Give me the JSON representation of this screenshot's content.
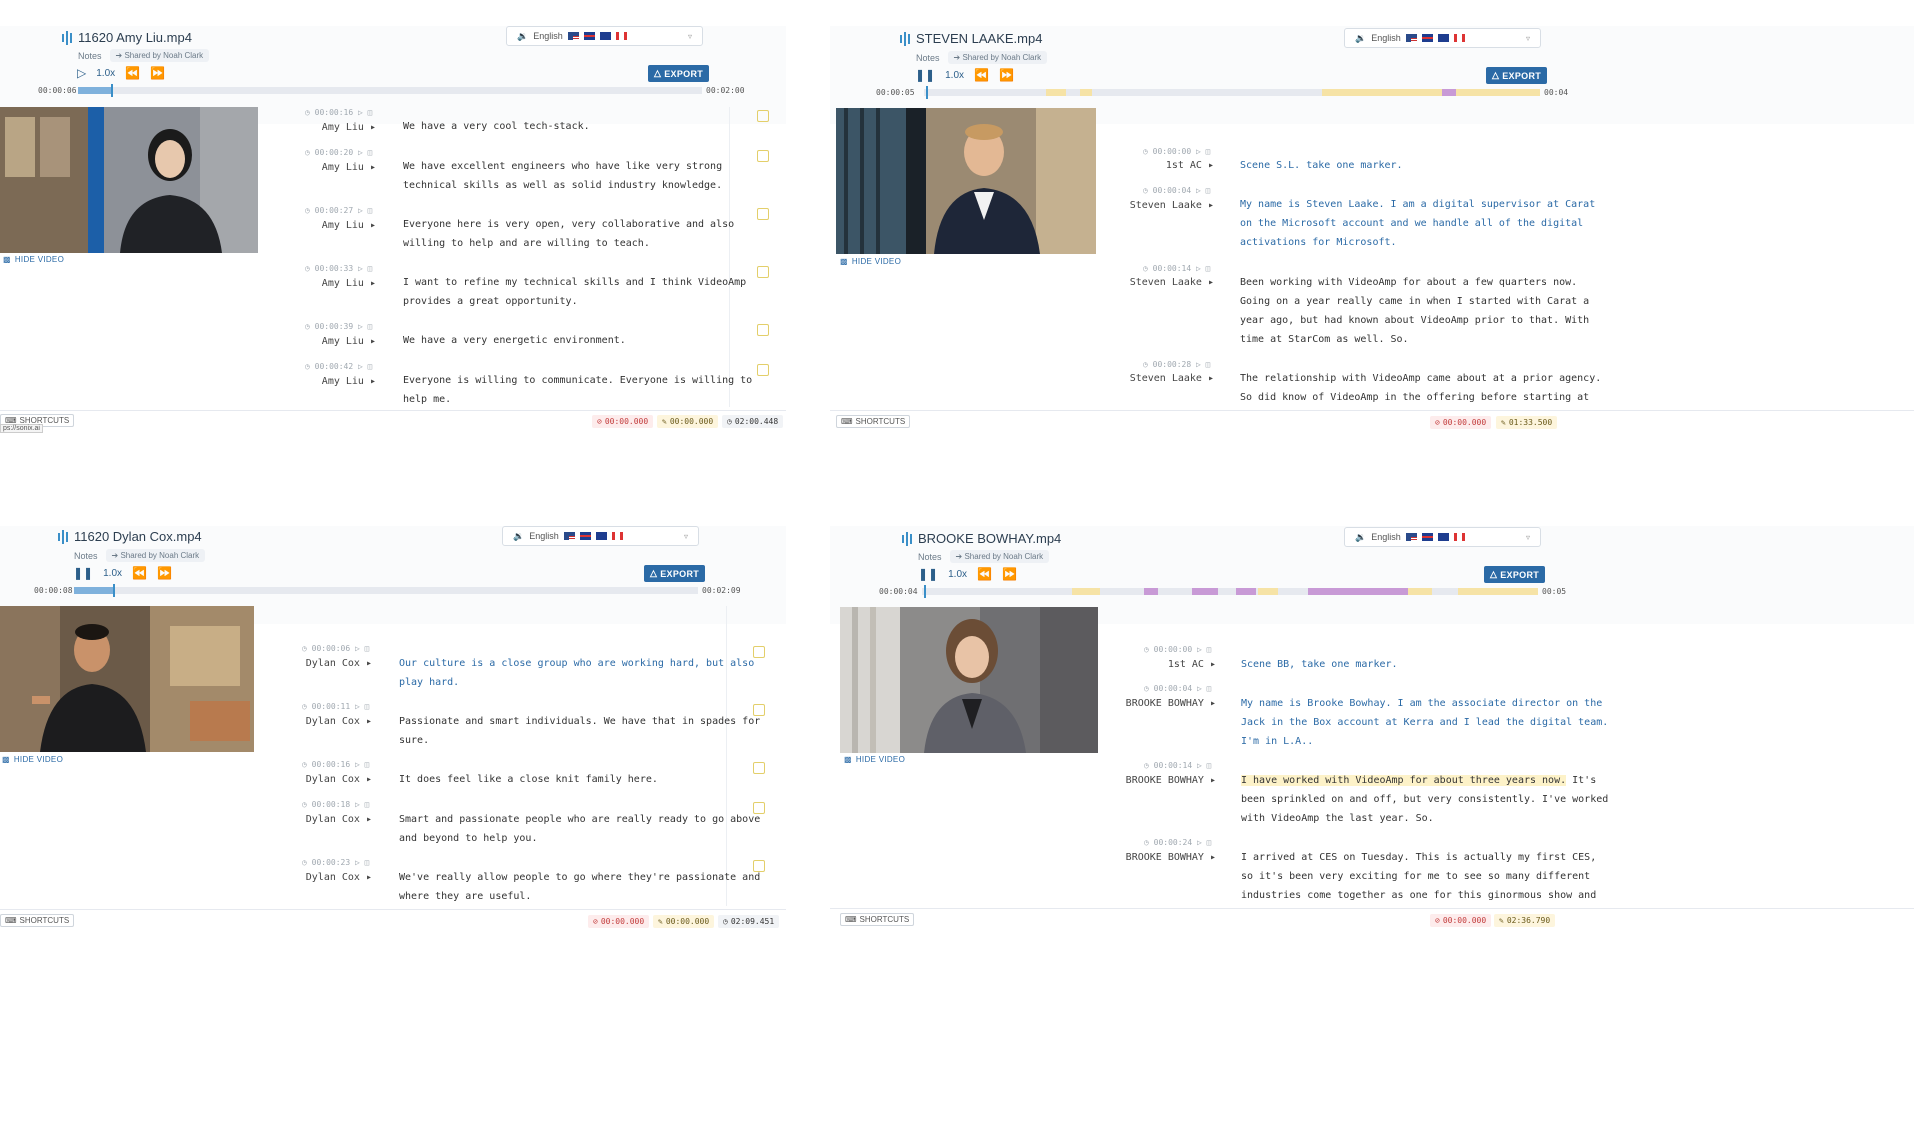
{
  "colors": {
    "accent": "#2b6aa6",
    "progress": "#7fb1dc",
    "track": "#e6e9ef",
    "segment_yellow": "#f6e3a6",
    "segment_purple": "#c89ad6",
    "note_icon": "#e3cf6a"
  },
  "icons": [
    "waveform-icon",
    "play-icon",
    "pause-icon",
    "rewind-icon",
    "fast-forward-icon",
    "clock-icon",
    "note-icon",
    "flag-icons",
    "export-icon",
    "hide-video-icon",
    "keyboard-icon",
    "edit-icon"
  ],
  "common": {
    "notes_label": "Notes",
    "shared_label": "Shared by Noah Clark",
    "language": "English",
    "export_label": "EXPORT",
    "hide_video_label": "HIDE VIDEO",
    "shortcuts_label": "SHORTCUTS",
    "speed": "1.0x"
  },
  "panels": [
    {
      "title": "11620 Amy Liu.mp4",
      "playing": false,
      "time_current": "00:00:06",
      "time_total": "00:02:00",
      "progress": 0.06,
      "entries": [
        {
          "time": "00:00:16",
          "speaker": "Amy Liu",
          "lines": [
            "We have a very cool tech-stack."
          ],
          "blue": false
        },
        {
          "time": "00:00:20",
          "speaker": "Amy Liu",
          "lines": [
            "We have excellent engineers who have like very strong",
            "technical skills as well as solid industry knowledge."
          ],
          "blue": false
        },
        {
          "time": "00:00:27",
          "speaker": "Amy Liu",
          "lines": [
            "Everyone here is very open, very collaborative and also",
            "willing to help and are willing to teach."
          ],
          "blue": false
        },
        {
          "time": "00:00:33",
          "speaker": "Amy Liu",
          "lines": [
            "I want to refine my technical skills and I think VideoAmp",
            "provides a great opportunity."
          ],
          "blue": false
        },
        {
          "time": "00:00:39",
          "speaker": "Amy Liu",
          "lines": [
            "We have a very energetic environment."
          ],
          "blue": false
        },
        {
          "time": "00:00:42",
          "speaker": "Amy Liu",
          "lines": [
            "Everyone is willing to communicate. Everyone is willing to",
            "help me."
          ],
          "blue": false
        }
      ],
      "footer": {
        "red": "00:00.000",
        "yellow": "00:00.000",
        "gray": "02:00.448"
      },
      "url_fragment": "ps://sonix.ai"
    },
    {
      "title": "STEVEN LAAKE.mp4",
      "playing": true,
      "time_current": "00:00:05",
      "time_total": "00:04",
      "progress": 0.0,
      "entries": [
        {
          "time": "00:00:00",
          "speaker": "1st AC",
          "lines": [
            "Scene S.L. take one marker."
          ],
          "blue": true
        },
        {
          "time": "00:00:04",
          "speaker": "Steven Laake",
          "lines": [
            "My name is Steven Laake. I am a digital supervisor at Carat",
            "on the Microsoft account and we handle all of the digital",
            "activations for Microsoft."
          ],
          "blue": true
        },
        {
          "time": "00:00:14",
          "speaker": "Steven Laake",
          "lines": [
            "Been working with VideoAmp for about a few quarters now.",
            "Going on a year really came in when I started with Carat a",
            "year ago, but had known about VideoAmp prior to that. With",
            "time at StarCom as well. So."
          ],
          "blue": false
        },
        {
          "time": "00:00:28",
          "speaker": "Steven Laake",
          "lines": [
            "The relationship with VideoAmp came about at a prior agency.",
            "So did know of VideoAmp in the offering before starting at"
          ],
          "blue": false
        }
      ],
      "footer": {
        "red": "00:00.000",
        "yellow": "01:33.500",
        "gray": ""
      }
    },
    {
      "title": "11620 Dylan Cox.mp4",
      "playing": true,
      "time_current": "00:00:08",
      "time_total": "00:02:09",
      "progress": 0.065,
      "entries": [
        {
          "time": "00:00:06",
          "speaker": "Dylan Cox",
          "lines": [
            "Our culture is a close group who are working hard, but also",
            "play hard."
          ],
          "blue": true
        },
        {
          "time": "00:00:11",
          "speaker": "Dylan Cox",
          "lines": [
            "Passionate and smart individuals. We have that in spades for",
            "sure."
          ],
          "blue": false
        },
        {
          "time": "00:00:16",
          "speaker": "Dylan Cox",
          "lines": [
            "It does feel like a close knit family here."
          ],
          "blue": false
        },
        {
          "time": "00:00:18",
          "speaker": "Dylan Cox",
          "lines": [
            "Smart and passionate people who are really ready to go above",
            "and beyond to help you."
          ],
          "blue": false
        },
        {
          "time": "00:00:23",
          "speaker": "Dylan Cox",
          "lines": [
            "We've really allow people to go where they're passionate and",
            "where they are useful."
          ],
          "blue": false
        }
      ],
      "footer": {
        "red": "00:00.000",
        "yellow": "00:00.000",
        "gray": "02:09.451"
      }
    },
    {
      "title": "BROOKE BOWHAY.mp4",
      "playing": true,
      "time_current": "00:00:04",
      "time_total": "00:05",
      "progress": 0.0,
      "entries": [
        {
          "time": "00:00:00",
          "speaker": "1st AC",
          "lines": [
            "Scene BB, take one marker."
          ],
          "blue": true
        },
        {
          "time": "00:00:04",
          "speaker": "BROOKE BOWHAY",
          "lines": [
            "My name is Brooke Bowhay. I am the associate director on the",
            "Jack in the Box account at Kerra and I lead the digital team.",
            "I'm in L.A.."
          ],
          "blue": true
        },
        {
          "time": "00:00:14",
          "speaker": "BROOKE BOWHAY",
          "lines": [
            "I have worked with VideoAmp for about three years now. It's",
            "been sprinkled on and off, but very consistently. I've worked",
            "with VideoAmp the last year. So."
          ],
          "blue": false,
          "highlight_first": "I have worked with VideoAmp for about three years now."
        },
        {
          "time": "00:00:24",
          "speaker": "BROOKE BOWHAY",
          "lines": [
            "I arrived at CES on Tuesday. This is actually my first CES,",
            "so it's been very exciting for me to see so many different",
            "industries come together as one for this ginormous show and"
          ],
          "blue": false
        }
      ],
      "footer": {
        "red": "00:00.000",
        "yellow": "02:36.790",
        "gray": ""
      }
    }
  ]
}
